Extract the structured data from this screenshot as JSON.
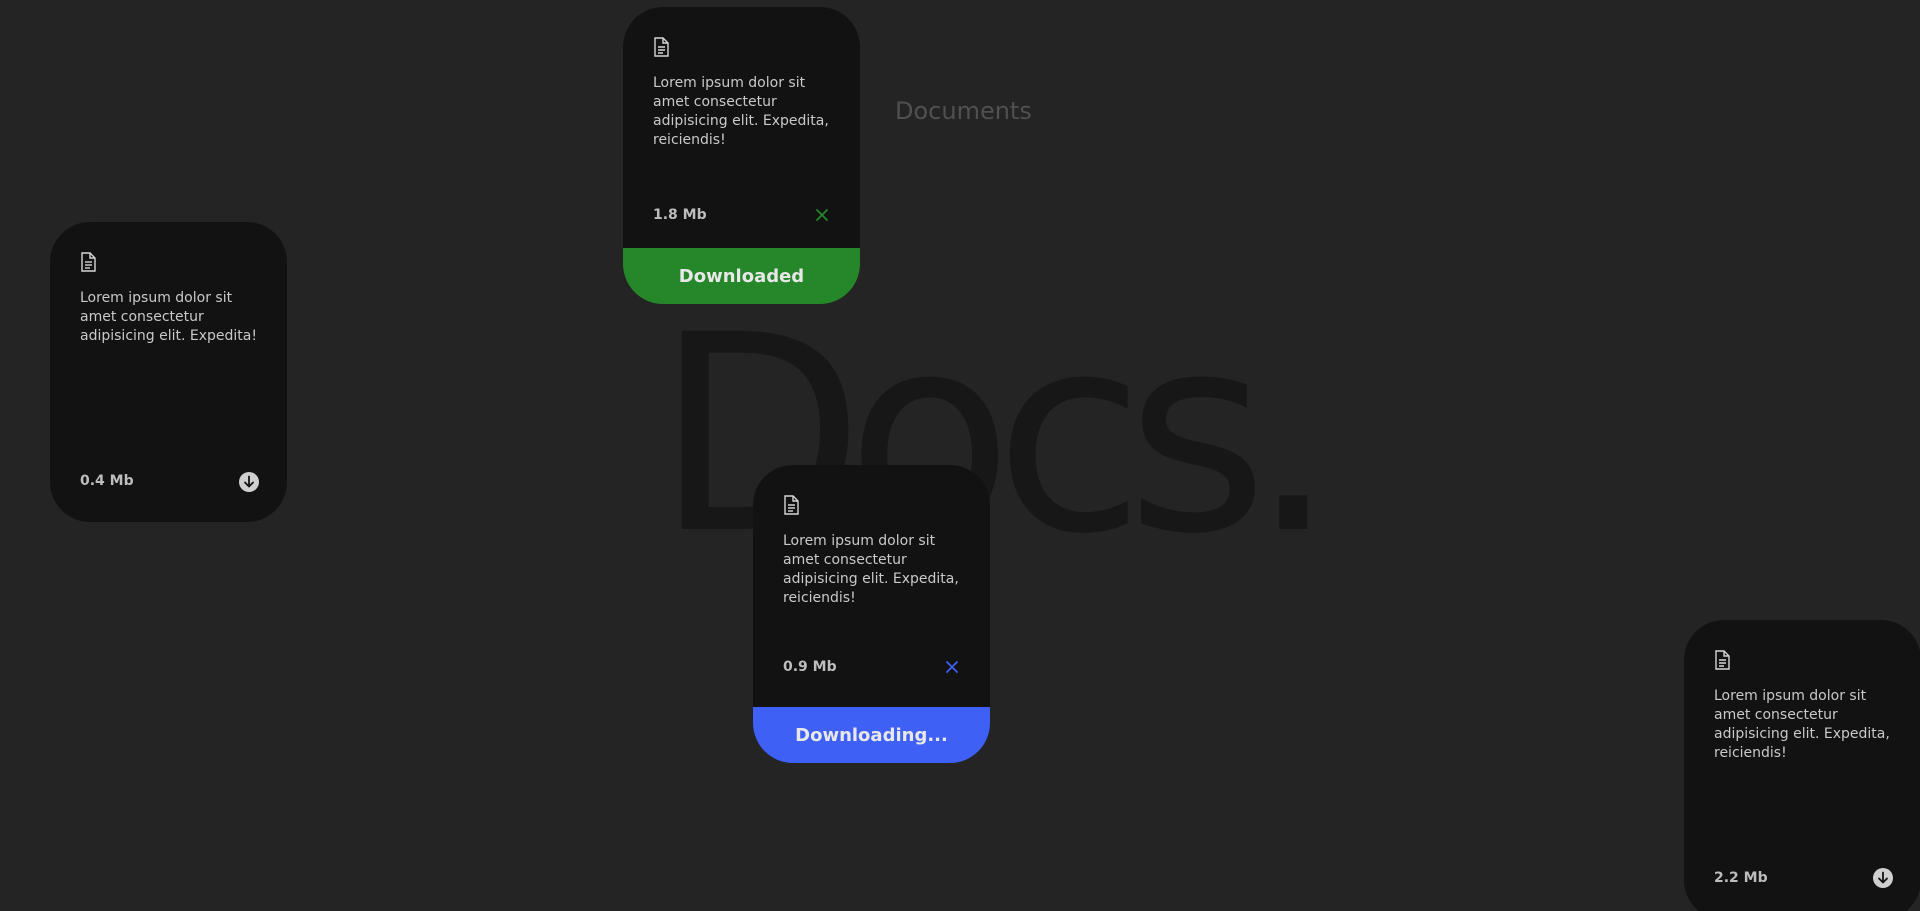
{
  "page": {
    "hero_text": "Docs.",
    "section_title": "Documents"
  },
  "colors": {
    "background": "#242424",
    "card": "#121212",
    "downloaded": "#25862A",
    "downloading": "#3E60F5"
  },
  "cards": [
    {
      "description": "Lorem ipsum dolor sit amet consectetur adipisicing elit. Expedita!",
      "size": "0.4 Mb",
      "state": "idle",
      "action_icon": "download-icon",
      "status_label": ""
    },
    {
      "description": "Lorem ipsum dolor sit amet consectetur adipisicing elit. Expedita, reiciendis!",
      "size": "1.8 Mb",
      "state": "downloaded",
      "action_icon": "close-icon",
      "status_label": "Downloaded"
    },
    {
      "description": "Lorem ipsum dolor sit amet consectetur adipisicing elit. Expedita, reiciendis!",
      "size": "0.9 Mb",
      "state": "downloading",
      "action_icon": "close-icon",
      "status_label": "Downloading..."
    },
    {
      "description": "Lorem ipsum dolor sit amet consectetur adipisicing elit. Expedita, reiciendis!",
      "size": "2.2 Mb",
      "state": "idle",
      "action_icon": "download-icon",
      "status_label": ""
    }
  ]
}
